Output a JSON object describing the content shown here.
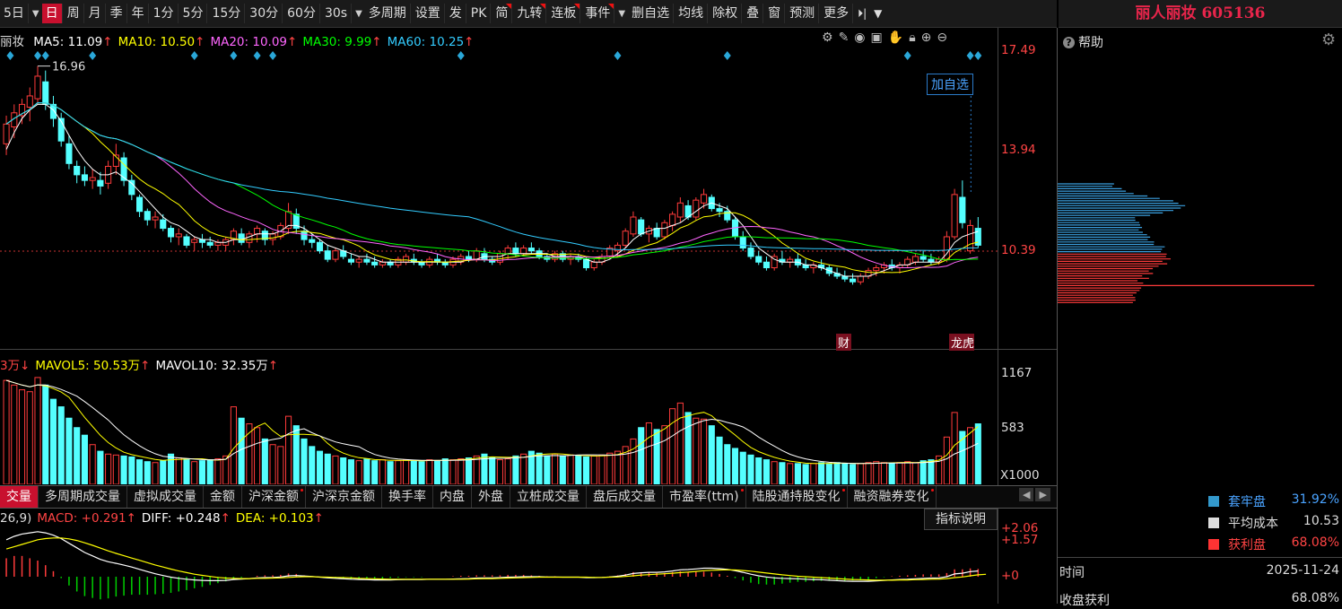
{
  "toolbar": {
    "items": [
      {
        "label": "5日",
        "dropdown": true
      },
      {
        "label": "日",
        "active": true
      },
      {
        "label": "周"
      },
      {
        "label": "月"
      },
      {
        "label": "季"
      },
      {
        "label": "年"
      },
      {
        "label": "1分"
      },
      {
        "label": "5分"
      },
      {
        "label": "15分"
      },
      {
        "label": "30分"
      },
      {
        "label": "60分"
      },
      {
        "label": "30s",
        "dropdown": true
      },
      {
        "label": "多周期"
      },
      {
        "label": "设置"
      },
      {
        "label": "发"
      },
      {
        "label": "PK"
      },
      {
        "label": "简",
        "mark": true
      },
      {
        "label": "九转",
        "mark": true
      },
      {
        "label": "连板",
        "mark": true
      },
      {
        "label": "事件",
        "dropdown": true,
        "mark": true
      },
      {
        "label": "删自选"
      },
      {
        "label": "均线"
      },
      {
        "label": "除权"
      },
      {
        "label": "叠"
      },
      {
        "label": "窗"
      },
      {
        "label": "预测"
      },
      {
        "label": "更多"
      }
    ]
  },
  "stock_title": "丽人丽妆 605136",
  "kline": {
    "stock_short": "丽妆",
    "ma": [
      {
        "label": "MA5: 11.09",
        "color": "#ffffff",
        "arrow": "↑"
      },
      {
        "label": "MA10: 10.50",
        "color": "#ffff00",
        "arrow": "↑"
      },
      {
        "label": "MA20: 10.09",
        "color": "#ff66ff",
        "arrow": "↑"
      },
      {
        "label": "MA30: 9.99",
        "color": "#00ff00",
        "arrow": "↑"
      },
      {
        "label": "MA60: 10.25",
        "color": "#33ccff",
        "arrow": "↑"
      }
    ],
    "y_ticks": [
      "17.49",
      "13.94",
      "10.39"
    ],
    "y_min": 6.5,
    "y_max": 17.49,
    "high_label": "16.96",
    "add_watch": "加自选",
    "event_labels": [
      "财",
      "龙虎榜"
    ]
  },
  "volume": {
    "header": [
      {
        "label": "3万",
        "color": "#ff4444",
        "arrow": "↓"
      },
      {
        "label": "MAVOL5: 50.53万",
        "color": "#ffff00",
        "arrow": "↑"
      },
      {
        "label": "MAVOL10: 32.35万",
        "color": "#ffffff",
        "arrow": "↑"
      }
    ],
    "y_ticks": [
      "1167",
      "583"
    ],
    "unit": "X1000"
  },
  "indicator_tabs": [
    {
      "label": "交量",
      "active": true
    },
    {
      "label": "多周期成交量"
    },
    {
      "label": "虚拟成交量"
    },
    {
      "label": "金额"
    },
    {
      "label": "沪深金额",
      "dot": true
    },
    {
      "label": "沪深京金额"
    },
    {
      "label": "换手率"
    },
    {
      "label": "内盘"
    },
    {
      "label": "外盘"
    },
    {
      "label": "立桩成交量"
    },
    {
      "label": "盘后成交量"
    },
    {
      "label": "市盈率(ttm)",
      "dot": true
    },
    {
      "label": "陆股通持股变化",
      "dot": true
    },
    {
      "label": "融资融券变化",
      "dot": true
    }
  ],
  "macd": {
    "header": [
      {
        "label": "26,9)",
        "color": "#dddddd",
        "arrow": ""
      },
      {
        "label": "MACD: +0.291",
        "color": "#ff4444",
        "arrow": "↑"
      },
      {
        "label": "DIFF: +0.248",
        "color": "#ffffff",
        "arrow": "↑"
      },
      {
        "label": "DEA: +0.103",
        "color": "#ffff00",
        "arrow": "↑"
      }
    ],
    "y_ticks": [
      "+2.06",
      "+1.57",
      "+0"
    ],
    "help": "指标说明"
  },
  "chip": {
    "help_label": "帮助",
    "legend": [
      {
        "label": "套牢盘",
        "value": "31.92%",
        "color": "#3399cc"
      },
      {
        "label": "平均成本",
        "value": "10.53",
        "color": "#dddddd"
      },
      {
        "label": "获利盘",
        "value": "68.08%",
        "color": "#ff3333"
      }
    ],
    "time_label": "时间",
    "time_value": "2025-11-24",
    "profit_label": "收盘获利",
    "profit_value": "68.08%"
  },
  "chart_data": {
    "type": "candlestick",
    "ohlc": [
      [
        14.2,
        15.2,
        13.8,
        14.9
      ],
      [
        14.8,
        15.6,
        14.4,
        15.3
      ],
      [
        15.2,
        15.8,
        14.9,
        15.6
      ],
      [
        15.5,
        16.2,
        15.0,
        15.9
      ],
      [
        15.8,
        16.96,
        15.6,
        16.6
      ],
      [
        16.4,
        16.8,
        15.4,
        15.6
      ],
      [
        15.6,
        15.9,
        14.8,
        15.1
      ],
      [
        15.1,
        15.3,
        14.1,
        14.3
      ],
      [
        14.2,
        14.5,
        13.3,
        13.5
      ],
      [
        13.4,
        13.6,
        12.8,
        13.1
      ],
      [
        13.1,
        13.4,
        12.7,
        12.9
      ],
      [
        12.9,
        13.3,
        12.6,
        13.0
      ],
      [
        12.9,
        13.2,
        12.4,
        12.7
      ],
      [
        12.8,
        13.6,
        12.6,
        13.4
      ],
      [
        13.4,
        14.2,
        13.1,
        13.8
      ],
      [
        13.7,
        13.9,
        12.7,
        12.9
      ],
      [
        12.9,
        13.1,
        12.2,
        12.4
      ],
      [
        12.3,
        12.4,
        11.6,
        11.8
      ],
      [
        11.8,
        11.9,
        11.3,
        11.5
      ],
      [
        11.5,
        11.8,
        11.2,
        11.6
      ],
      [
        11.5,
        11.7,
        11.1,
        11.2
      ],
      [
        11.2,
        11.3,
        10.7,
        10.9
      ],
      [
        10.9,
        11.2,
        10.6,
        11.0
      ],
      [
        10.9,
        11.0,
        10.5,
        10.6
      ],
      [
        10.7,
        10.9,
        10.4,
        10.8
      ],
      [
        10.8,
        11.0,
        10.5,
        10.7
      ],
      [
        10.7,
        10.9,
        10.5,
        10.6
      ],
      [
        10.6,
        10.8,
        10.4,
        10.7
      ],
      [
        10.6,
        10.9,
        10.4,
        10.8
      ],
      [
        10.8,
        11.2,
        10.6,
        11.1
      ],
      [
        11.0,
        11.2,
        10.6,
        10.7
      ],
      [
        10.7,
        11.1,
        10.5,
        11.0
      ],
      [
        11.0,
        11.3,
        10.7,
        11.2
      ],
      [
        11.1,
        11.2,
        10.6,
        10.8
      ],
      [
        10.8,
        11.1,
        10.6,
        11.0
      ],
      [
        10.9,
        11.4,
        10.8,
        11.3
      ],
      [
        11.2,
        12.1,
        11.0,
        11.8
      ],
      [
        11.7,
        11.9,
        11.0,
        11.2
      ],
      [
        11.1,
        11.3,
        10.6,
        10.8
      ],
      [
        10.8,
        11.0,
        10.5,
        10.7
      ],
      [
        10.7,
        10.8,
        10.3,
        10.4
      ],
      [
        10.4,
        10.6,
        10.0,
        10.1
      ],
      [
        10.1,
        10.5,
        10.0,
        10.4
      ],
      [
        10.4,
        10.6,
        10.1,
        10.2
      ],
      [
        10.1,
        10.3,
        9.9,
        10.0
      ],
      [
        10.0,
        10.2,
        9.8,
        10.1
      ],
      [
        10.1,
        10.3,
        9.9,
        10.0
      ],
      [
        10.0,
        10.2,
        9.8,
        9.9
      ],
      [
        9.9,
        10.1,
        9.8,
        10.0
      ],
      [
        10.0,
        10.1,
        9.8,
        9.9
      ],
      [
        9.9,
        10.2,
        9.8,
        10.1
      ],
      [
        10.0,
        10.3,
        9.9,
        10.2
      ],
      [
        10.1,
        10.3,
        9.9,
        10.0
      ],
      [
        10.0,
        10.1,
        9.8,
        9.9
      ],
      [
        9.9,
        10.2,
        9.8,
        10.1
      ],
      [
        10.1,
        10.3,
        9.9,
        10.0
      ],
      [
        10.0,
        10.1,
        9.8,
        9.9
      ],
      [
        9.9,
        10.2,
        9.8,
        10.1
      ],
      [
        10.0,
        10.3,
        9.9,
        10.2
      ],
      [
        10.2,
        10.4,
        10.0,
        10.1
      ],
      [
        10.1,
        10.5,
        10.0,
        10.4
      ],
      [
        10.3,
        10.5,
        10.0,
        10.1
      ],
      [
        10.1,
        10.2,
        9.9,
        10.0
      ],
      [
        10.0,
        10.4,
        9.9,
        10.3
      ],
      [
        10.3,
        10.6,
        10.1,
        10.5
      ],
      [
        10.5,
        10.7,
        10.2,
        10.3
      ],
      [
        10.3,
        10.6,
        10.2,
        10.5
      ],
      [
        10.5,
        10.7,
        10.3,
        10.4
      ],
      [
        10.4,
        10.5,
        10.1,
        10.2
      ],
      [
        10.2,
        10.3,
        10.0,
        10.1
      ],
      [
        10.1,
        10.4,
        10.0,
        10.3
      ],
      [
        10.3,
        10.4,
        10.0,
        10.1
      ],
      [
        10.1,
        10.3,
        9.9,
        10.2
      ],
      [
        10.2,
        10.3,
        10.0,
        10.1
      ],
      [
        10.1,
        10.2,
        9.7,
        9.8
      ],
      [
        9.8,
        10.1,
        9.7,
        10.0
      ],
      [
        10.0,
        10.3,
        9.9,
        10.2
      ],
      [
        10.2,
        10.6,
        10.1,
        10.5
      ],
      [
        10.4,
        10.7,
        10.2,
        10.6
      ],
      [
        10.6,
        11.2,
        10.5,
        11.1
      ],
      [
        11.0,
        11.8,
        10.9,
        11.6
      ],
      [
        11.5,
        11.6,
        10.9,
        11.0
      ],
      [
        11.0,
        11.3,
        10.7,
        11.2
      ],
      [
        11.2,
        11.4,
        10.8,
        10.9
      ],
      [
        10.9,
        11.5,
        10.8,
        11.4
      ],
      [
        11.3,
        11.8,
        11.1,
        11.7
      ],
      [
        11.6,
        12.3,
        11.4,
        12.1
      ],
      [
        12.0,
        12.2,
        11.5,
        11.6
      ],
      [
        11.6,
        12.3,
        11.5,
        12.2
      ],
      [
        12.1,
        12.6,
        11.9,
        12.4
      ],
      [
        12.3,
        12.4,
        11.8,
        11.9
      ],
      [
        11.9,
        12.1,
        11.6,
        11.8
      ],
      [
        11.8,
        12.0,
        11.4,
        11.5
      ],
      [
        11.5,
        11.6,
        10.8,
        10.9
      ],
      [
        10.9,
        11.1,
        10.4,
        10.5
      ],
      [
        10.5,
        10.7,
        10.1,
        10.2
      ],
      [
        10.2,
        10.4,
        9.9,
        10.0
      ],
      [
        10.0,
        10.2,
        9.7,
        9.8
      ],
      [
        9.8,
        10.3,
        9.7,
        10.2
      ],
      [
        10.1,
        10.4,
        9.9,
        10.0
      ],
      [
        10.0,
        10.2,
        9.8,
        10.1
      ],
      [
        10.1,
        10.3,
        9.8,
        9.9
      ],
      [
        9.9,
        10.1,
        9.7,
        9.8
      ],
      [
        9.8,
        10.0,
        9.6,
        9.9
      ],
      [
        9.9,
        10.1,
        9.7,
        9.8
      ],
      [
        9.8,
        9.9,
        9.5,
        9.6
      ],
      [
        9.6,
        9.8,
        9.4,
        9.5
      ],
      [
        9.5,
        9.7,
        9.3,
        9.4
      ],
      [
        9.4,
        9.6,
        9.2,
        9.3
      ],
      [
        9.3,
        9.6,
        9.2,
        9.5
      ],
      [
        9.5,
        9.8,
        9.4,
        9.7
      ],
      [
        9.7,
        9.9,
        9.5,
        9.8
      ],
      [
        9.8,
        10.0,
        9.6,
        9.9
      ],
      [
        9.9,
        10.1,
        9.7,
        9.8
      ],
      [
        9.8,
        10.0,
        9.6,
        9.9
      ],
      [
        9.9,
        10.2,
        9.8,
        10.1
      ],
      [
        10.0,
        10.3,
        9.9,
        10.2
      ],
      [
        10.2,
        10.4,
        10.0,
        10.1
      ],
      [
        10.1,
        10.3,
        9.9,
        10.0
      ],
      [
        10.0,
        10.2,
        9.9,
        10.1
      ],
      [
        10.1,
        11.1,
        10.0,
        10.9
      ],
      [
        10.9,
        12.6,
        10.8,
        12.4
      ],
      [
        12.3,
        12.9,
        11.2,
        11.4
      ],
      [
        10.4,
        11.5,
        10.3,
        11.3
      ],
      [
        11.2,
        11.6,
        10.5,
        10.6
      ]
    ],
    "volume": [
      1100,
      1050,
      1000,
      980,
      1130,
      1050,
      900,
      820,
      700,
      600,
      520,
      420,
      350,
      320,
      310,
      300,
      290,
      260,
      240,
      230,
      250,
      320,
      280,
      260,
      240,
      250,
      260,
      270,
      300,
      820,
      700,
      640,
      600,
      480,
      420,
      400,
      720,
      620,
      480,
      400,
      350,
      320,
      300,
      280,
      260,
      250,
      270,
      250,
      260,
      240,
      250,
      260,
      250,
      240,
      260,
      250,
      270,
      260,
      270,
      280,
      300,
      320,
      280,
      260,
      270,
      300,
      320,
      350,
      330,
      300,
      320,
      300,
      310,
      300,
      290,
      300,
      310,
      330,
      350,
      400,
      480,
      600,
      650,
      580,
      620,
      800,
      860,
      760,
      700,
      690,
      620,
      500,
      420,
      380,
      340,
      310,
      280,
      260,
      240,
      230,
      220,
      220,
      210,
      220,
      230,
      220,
      230,
      220,
      210,
      220,
      230,
      240,
      230,
      220,
      230,
      240,
      230,
      250,
      260,
      300,
      500,
      760,
      560,
      600,
      640
    ],
    "ma5": [
      14.0,
      14.6,
      15.1,
      15.4,
      15.6,
      15.6,
      15.4,
      15.0,
      14.5,
      14.0,
      13.6,
      13.3,
      13.1,
      13.1,
      13.2,
      13.0,
      12.8,
      12.5,
      12.2,
      11.9,
      11.6,
      11.4,
      11.3,
      11.1,
      10.9,
      10.8,
      10.8,
      10.7,
      10.7,
      10.8,
      10.8,
      10.9,
      11.0,
      11.0,
      11.0,
      11.1,
      11.3,
      11.3,
      11.2,
      11.0,
      10.8,
      10.6,
      10.5,
      10.4,
      10.3,
      10.2,
      10.2,
      10.1,
      10.0,
      10.0,
      10.0,
      10.0,
      10.0,
      10.0,
      10.0,
      10.0,
      10.0,
      10.0,
      10.0,
      10.1,
      10.1,
      10.2,
      10.2,
      10.2,
      10.3,
      10.3,
      10.3,
      10.3,
      10.3,
      10.3,
      10.2,
      10.2,
      10.2,
      10.2,
      10.1,
      10.0,
      10.0,
      10.1,
      10.3,
      10.5,
      10.8,
      11.0,
      11.1,
      11.2,
      11.2,
      11.3,
      11.4,
      11.6,
      11.8,
      12.0,
      12.1,
      12.0,
      11.9,
      11.6,
      11.3,
      10.9,
      10.5,
      10.3,
      10.1,
      10.0,
      10.0,
      10.0,
      9.9,
      9.9,
      9.8,
      9.7,
      9.6,
      9.5,
      9.5,
      9.5,
      9.5,
      9.6,
      9.7,
      9.8,
      9.9,
      9.9,
      10.0,
      10.0,
      10.0,
      10.0,
      10.3,
      10.7,
      10.9,
      11.0,
      11.09
    ],
    "macd_diff": [
      1.6,
      1.75,
      1.85,
      1.9,
      1.95,
      1.9,
      1.8,
      1.65,
      1.45,
      1.25,
      1.05,
      0.9,
      0.75,
      0.65,
      0.58,
      0.5,
      0.42,
      0.32,
      0.22,
      0.13,
      0.05,
      -0.02,
      -0.07,
      -0.11,
      -0.14,
      -0.16,
      -0.17,
      -0.17,
      -0.16,
      -0.12,
      -0.1,
      -0.08,
      -0.05,
      -0.04,
      -0.03,
      -0.01,
      0.04,
      0.05,
      0.03,
      0.01,
      -0.02,
      -0.05,
      -0.07,
      -0.09,
      -0.11,
      -0.12,
      -0.13,
      -0.14,
      -0.14,
      -0.14,
      -0.13,
      -0.12,
      -0.12,
      -0.12,
      -0.11,
      -0.11,
      -0.11,
      -0.1,
      -0.09,
      -0.08,
      -0.06,
      -0.05,
      -0.05,
      -0.04,
      -0.02,
      -0.01,
      0.0,
      0.0,
      0.0,
      -0.01,
      -0.01,
      -0.02,
      -0.02,
      -0.02,
      -0.04,
      -0.04,
      -0.03,
      -0.01,
      0.02,
      0.07,
      0.14,
      0.17,
      0.19,
      0.19,
      0.21,
      0.25,
      0.3,
      0.31,
      0.34,
      0.37,
      0.37,
      0.35,
      0.32,
      0.26,
      0.19,
      0.11,
      0.04,
      -0.01,
      -0.05,
      -0.07,
      -0.08,
      -0.09,
      -0.11,
      -0.12,
      -0.13,
      -0.15,
      -0.17,
      -0.19,
      -0.2,
      -0.2,
      -0.2,
      -0.18,
      -0.16,
      -0.14,
      -0.12,
      -0.11,
      -0.09,
      -0.07,
      -0.06,
      -0.05,
      0.0,
      0.12,
      0.15,
      0.22,
      0.248
    ],
    "macd_dea": [
      1.2,
      1.3,
      1.4,
      1.5,
      1.6,
      1.65,
      1.68,
      1.68,
      1.64,
      1.57,
      1.47,
      1.36,
      1.24,
      1.12,
      1.01,
      0.91,
      0.81,
      0.71,
      0.61,
      0.51,
      0.42,
      0.33,
      0.25,
      0.18,
      0.11,
      0.06,
      0.01,
      -0.03,
      -0.06,
      -0.07,
      -0.08,
      -0.08,
      -0.07,
      -0.07,
      -0.06,
      -0.05,
      -0.03,
      -0.01,
      0.0,
      0.0,
      -0.01,
      -0.02,
      -0.03,
      -0.04,
      -0.05,
      -0.07,
      -0.08,
      -0.09,
      -0.1,
      -0.11,
      -0.11,
      -0.11,
      -0.11,
      -0.11,
      -0.11,
      -0.11,
      -0.11,
      -0.11,
      -0.11,
      -0.1,
      -0.09,
      -0.08,
      -0.08,
      -0.07,
      -0.06,
      -0.05,
      -0.04,
      -0.03,
      -0.02,
      -0.02,
      -0.02,
      -0.02,
      -0.02,
      -0.02,
      -0.02,
      -0.03,
      -0.03,
      -0.02,
      -0.01,
      0.01,
      0.04,
      0.07,
      0.09,
      0.11,
      0.13,
      0.15,
      0.18,
      0.2,
      0.23,
      0.26,
      0.28,
      0.29,
      0.3,
      0.29,
      0.27,
      0.24,
      0.2,
      0.16,
      0.12,
      0.08,
      0.05,
      0.02,
      0.0,
      -0.02,
      -0.04,
      -0.06,
      -0.08,
      -0.1,
      -0.12,
      -0.13,
      -0.14,
      -0.15,
      -0.15,
      -0.15,
      -0.14,
      -0.14,
      -0.13,
      -0.12,
      -0.11,
      -0.1,
      -0.08,
      -0.04,
      -0.01,
      0.04,
      0.08,
      0.103
    ]
  }
}
